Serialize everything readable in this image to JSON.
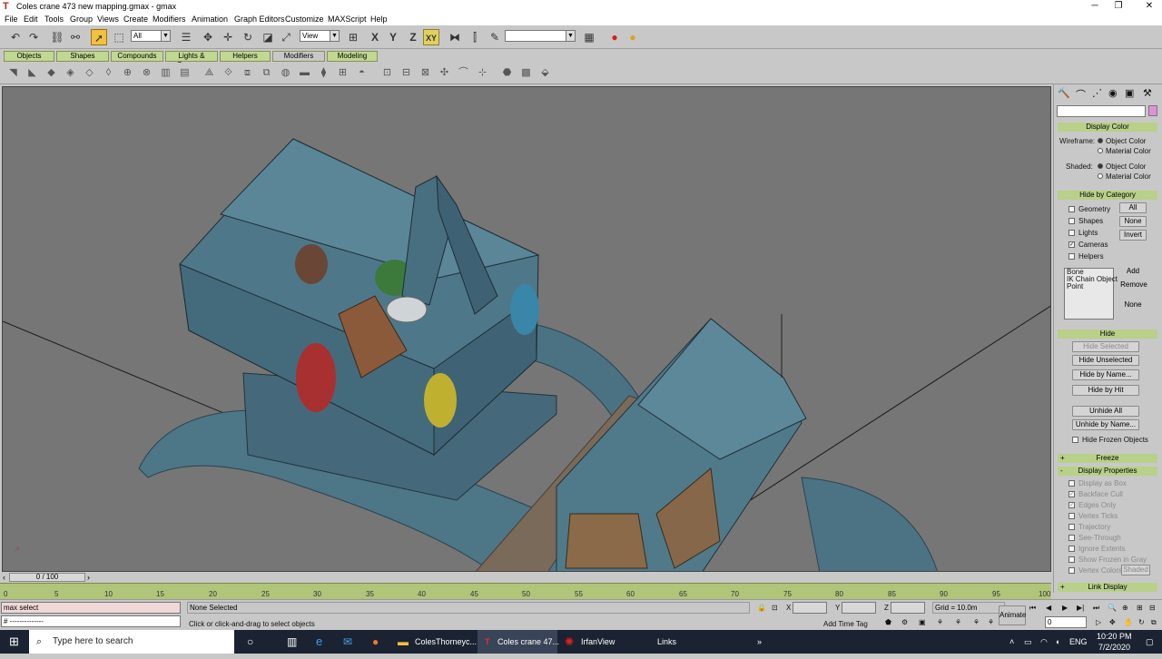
{
  "window": {
    "title": "Coles crane 473 new mapping.gmax - gmax",
    "minimize": "─",
    "maximize": "❐",
    "close": "✕"
  },
  "menu": [
    "File",
    "Edit",
    "Tools",
    "Group",
    "Views",
    "Create",
    "Modifiers",
    "Animation",
    "Graph Editors",
    "Customize",
    "MAXScript",
    "Help"
  ],
  "toolbar": {
    "selection_filter": "All",
    "ref_coord": "View",
    "axis_constraint": "XY",
    "named_selection": ""
  },
  "tabs": [
    {
      "label": "Objects"
    },
    {
      "label": "Shapes"
    },
    {
      "label": "Compounds"
    },
    {
      "label": "Lights & Cameras"
    },
    {
      "label": "Helpers"
    },
    {
      "label": "Modifiers"
    },
    {
      "label": "Modeling"
    }
  ],
  "command_panel": {
    "name_field": "",
    "display_color": {
      "header": "Display Color",
      "wireframe_label": "Wireframe:",
      "shaded_label": "Shaded:",
      "object_color": "Object Color",
      "material_color": "Material Color",
      "wireframe_selected": "object_color",
      "shaded_selected": "object_color"
    },
    "hide_by_category": {
      "header": "Hide by Category",
      "items": [
        {
          "label": "Geometry",
          "checked": false
        },
        {
          "label": "Shapes",
          "checked": false
        },
        {
          "label": "Lights",
          "checked": false
        },
        {
          "label": "Cameras",
          "checked": true
        },
        {
          "label": "Helpers",
          "checked": false
        }
      ],
      "all": "All",
      "none": "None",
      "invert": "Invert",
      "list": [
        "Bone",
        "IK Chain Object",
        "Point"
      ],
      "add": "Add",
      "remove": "Remove",
      "none2": "None"
    },
    "hide": {
      "header": "Hide",
      "hide_selected": "Hide Selected",
      "hide_unselected": "Hide Unselected",
      "hide_by_name": "Hide by Name...",
      "hide_by_hit": "Hide by Hit",
      "unhide_all": "Unhide All",
      "unhide_by_name": "Unhide by Name...",
      "hide_frozen": "Hide Frozen Objects"
    },
    "freeze": {
      "header": "Freeze",
      "plus": "+"
    },
    "display_properties": {
      "header": "Display Properties",
      "minus": "-",
      "items": [
        {
          "label": "Display as Box",
          "checked": false
        },
        {
          "label": "Backface Cull",
          "checked": true
        },
        {
          "label": "Edges Only",
          "checked": true
        },
        {
          "label": "Vertex Ticks",
          "checked": false
        },
        {
          "label": "Trajectory",
          "checked": false
        },
        {
          "label": "See-Through",
          "checked": false
        },
        {
          "label": "Ignore Extents",
          "checked": false
        },
        {
          "label": "Show Frozen in Gray",
          "checked": false
        },
        {
          "label": "Vertex Colors",
          "checked": false
        }
      ],
      "shaded_btn": "Shaded"
    },
    "link_display": {
      "header": "Link Display",
      "plus": "+"
    }
  },
  "timeline": {
    "frame_label": "0 / 100",
    "ticks": [
      "0",
      "5",
      "10",
      "15",
      "20",
      "25",
      "30",
      "35",
      "40",
      "45",
      "50",
      "55",
      "60",
      "65",
      "70",
      "75",
      "80",
      "85",
      "90",
      "95",
      "100"
    ]
  },
  "status": {
    "maxscript_line1": "max select",
    "maxscript_line2": "# --------------",
    "selection": "None Selected",
    "prompt": "Click or click-and-drag to select objects",
    "x_label": "X",
    "y_label": "Y",
    "z_label": "Z",
    "grid": "Grid = 10.0m",
    "add_time_tag": "Add Time Tag",
    "animate": "Animate",
    "frame_field": "0"
  },
  "taskbar": {
    "search_placeholder": "Type here to search",
    "apps": [
      {
        "label": "ColesThorneyc..."
      },
      {
        "label": "Coles crane 47..."
      },
      {
        "label": "IrfanView"
      }
    ],
    "links": "Links",
    "lang": "ENG",
    "time": "10:20 PM",
    "date": "7/2/2020"
  },
  "colors": {
    "ruler_green": "#b0c47a",
    "rollout_header": "#b8d088",
    "viewport_bg": "#767676",
    "model_blue": "#4a7485",
    "taskbar": "#1b2333"
  }
}
